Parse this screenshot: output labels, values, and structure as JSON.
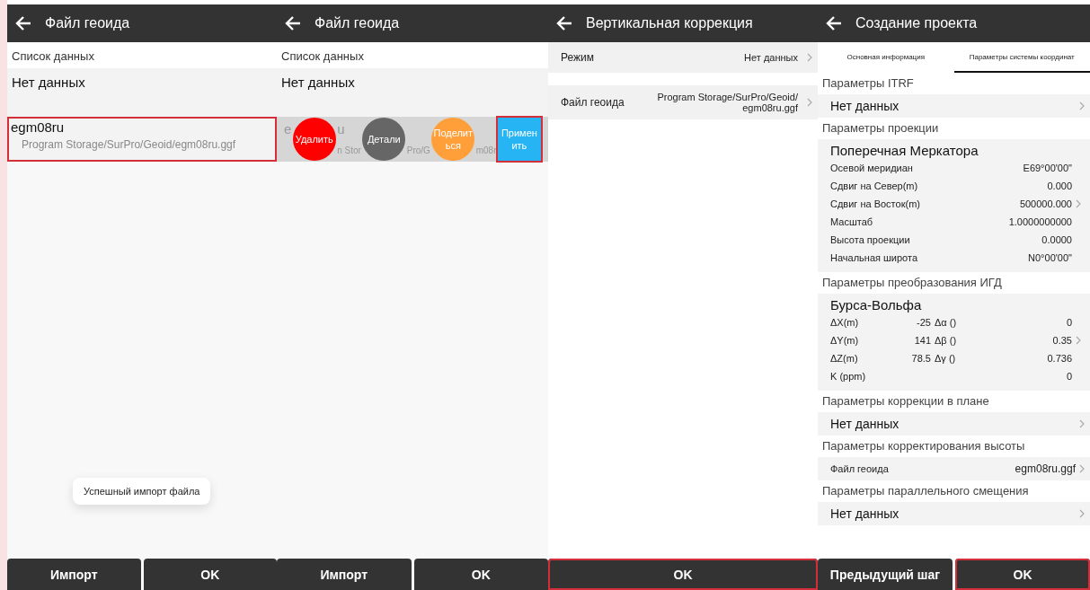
{
  "panels": [
    {
      "kind": "file_list",
      "title": "Файл геоида",
      "section_label": "Список данных",
      "empty_text": "Нет данных",
      "file": {
        "name": "egm08ru",
        "path": "Program Storage/SurPro/Geoid/egm08ru.ggf",
        "highlighted": true,
        "swiped": false
      },
      "toast": "Успешный импорт файла",
      "buttons": [
        {
          "label": "Импорт",
          "highlighted": false
        },
        {
          "label": "OK",
          "highlighted": false
        }
      ]
    },
    {
      "kind": "file_list",
      "title": "Файл геоида",
      "section_label": "Список данных",
      "empty_text": "Нет данных",
      "file": {
        "name_parts": [
          "e",
          "u"
        ],
        "path_parts": [
          "n Stor",
          "Pro/G",
          "m08r"
        ],
        "highlighted": false,
        "swiped": true
      },
      "actions": [
        {
          "label": "Удалить",
          "color": "#ff0000",
          "highlighted": false
        },
        {
          "label": "Детали",
          "color": "#666666",
          "highlighted": false
        },
        {
          "label": "Поделиться",
          "color": "#ff9f3a",
          "highlighted": false
        },
        {
          "label": "Применить",
          "color": "#26b4f5",
          "highlighted": true
        }
      ],
      "buttons": [
        {
          "label": "Импорт",
          "highlighted": false
        },
        {
          "label": "OK",
          "highlighted": false
        }
      ]
    },
    {
      "kind": "settings",
      "title": "Вертикальная коррекция",
      "rows": [
        {
          "label": "Режим",
          "value": "Нет данных"
        },
        {
          "label": "Файл геоида",
          "value": "Program Storage/SurPro/Geoid/ egm08ru.ggf"
        }
      ],
      "buttons": [
        {
          "label": "OK",
          "highlighted": true
        }
      ]
    },
    {
      "kind": "project",
      "title": "Создание проекта",
      "tabs": [
        {
          "label": "Основная информация",
          "selected": false
        },
        {
          "label": "Параметры системы координат",
          "selected": true
        }
      ],
      "sections": [
        {
          "header": "Параметры ITRF",
          "item": {
            "kind": "nodata",
            "text": "Нет данных"
          }
        },
        {
          "header": "Параметры проекции",
          "item": {
            "kind": "params",
            "name": "Поперечная Меркатора",
            "params": [
              {
                "label": "Осевой меридиан",
                "value": "E69°00'00\"",
                "arrow": false
              },
              {
                "label": "Сдвиг на Север(m)",
                "value": "0.000",
                "arrow": false
              },
              {
                "label": "Сдвиг на Восток(m)",
                "value": "500000.000",
                "arrow": true
              },
              {
                "label": "Масштаб",
                "value": "1.0000000000",
                "arrow": false
              },
              {
                "label": "Высота проекции",
                "value": "0.0000",
                "arrow": false
              },
              {
                "label": "Начальная широта",
                "value": "N0°00'00\"",
                "arrow": false
              }
            ]
          }
        },
        {
          "header": "Параметры преобразования ИГД",
          "item": {
            "kind": "grid",
            "name": "Бурса-Вольфа",
            "rows": [
              {
                "label": "ΔX(m)",
                "value": "-25",
                "label2": "Δα ()",
                "value2": "0",
                "arrow": false
              },
              {
                "label": "ΔY(m)",
                "value": "141",
                "label2": "Δβ ()",
                "value2": "0.35",
                "arrow": true
              },
              {
                "label": "ΔZ(m)",
                "value": "78.5",
                "label2": "Δγ ()",
                "value2": "0.736",
                "arrow": false
              },
              {
                "label": "K (ppm)",
                "value": "",
                "label2": "",
                "value2": "0",
                "arrow": false
              }
            ]
          }
        },
        {
          "header": "Параметры коррекции в плане",
          "item": {
            "kind": "nodata",
            "text": "Нет данных"
          }
        },
        {
          "header": "Параметры корректирования высоты",
          "item": {
            "kind": "file",
            "label": "Файл геоида",
            "value": "egm08ru.ggf"
          }
        },
        {
          "header": "Параметры параллельного смещения",
          "item": {
            "kind": "nodata",
            "text": "Нет данных"
          }
        }
      ],
      "buttons": [
        {
          "label": "Предыдущий шаг",
          "highlighted": false
        },
        {
          "label": "OK",
          "highlighted": true
        }
      ]
    }
  ]
}
